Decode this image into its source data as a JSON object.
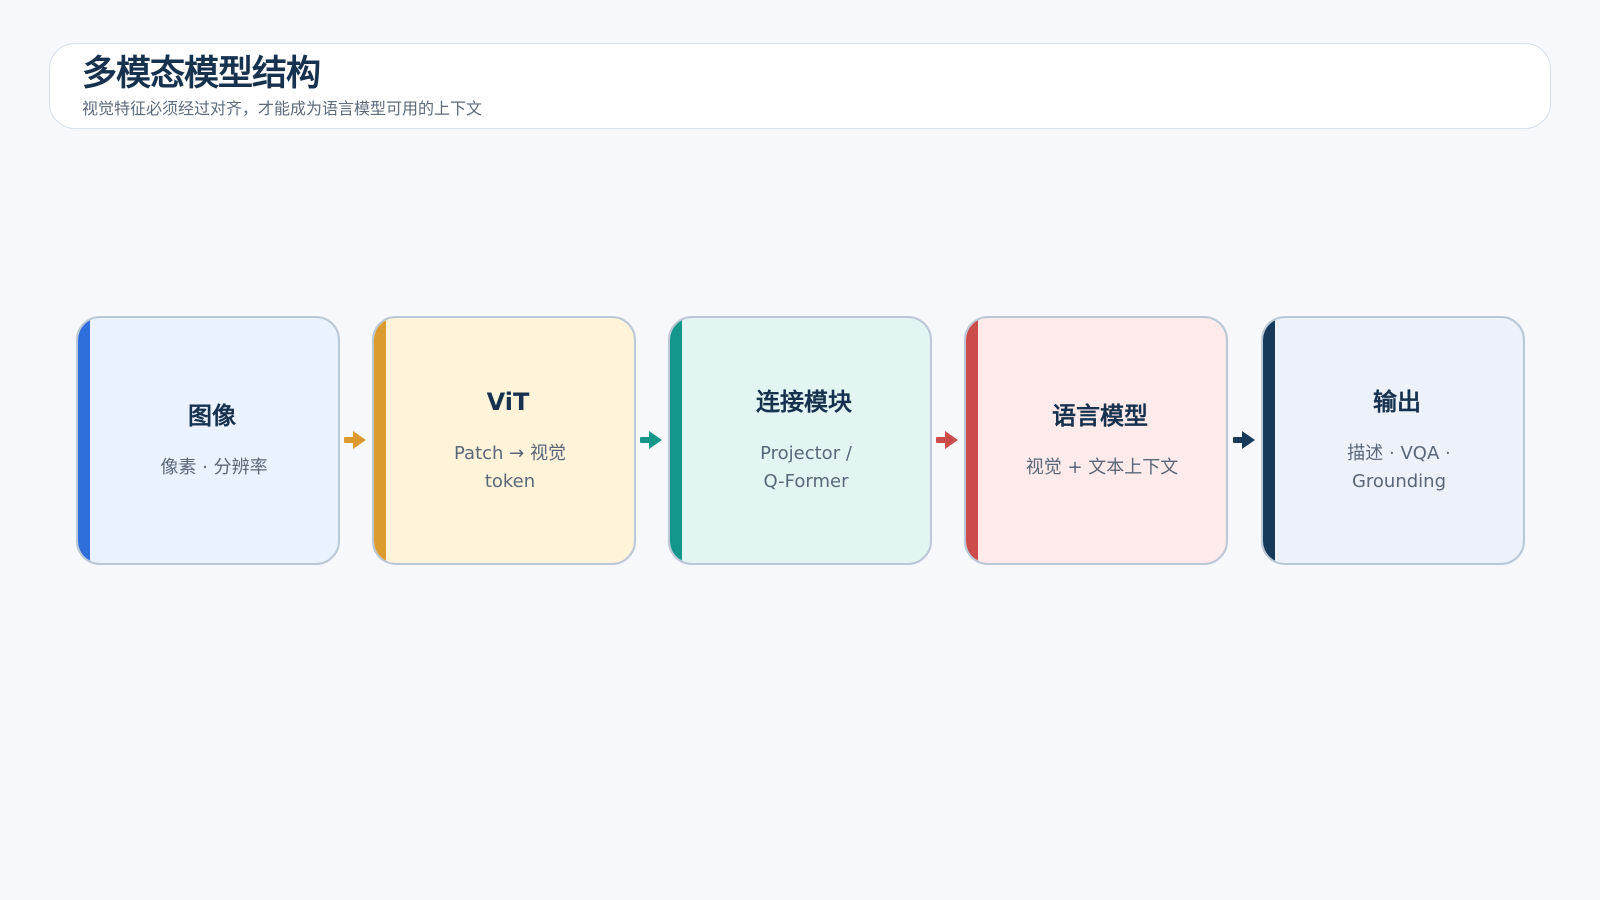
{
  "header": {
    "title": "多模态模型结构",
    "subtitle": "视觉特征必须经过对齐，才能成为语言模型可用的上下文"
  },
  "stages": [
    {
      "title": "图像",
      "desc": "像素 · 分辨率",
      "accent": "#2f6fdb",
      "bg": "#eaf2ff"
    },
    {
      "title": "ViT",
      "desc": "Patch → 视觉\ntoken",
      "accent": "#dc9b2e",
      "bg": "#fff3da"
    },
    {
      "title": "连接模块",
      "desc": "Projector /\nQ-Former",
      "accent": "#14968a",
      "bg": "#e3f5f3"
    },
    {
      "title": "语言模型",
      "desc": "视觉 + 文本上下文",
      "accent": "#cc4b4b",
      "bg": "#fdeaea"
    },
    {
      "title": "输出",
      "desc": "描述 · VQA ·\nGrounding",
      "accent": "#17395a",
      "bg": "#edf1fa"
    }
  ]
}
